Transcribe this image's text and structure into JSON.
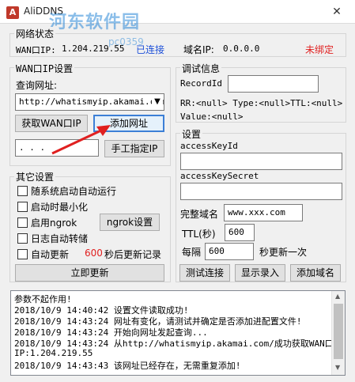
{
  "window": {
    "title": "AliDDNS",
    "watermark": "河东软件园",
    "watermark_url": "pc0359"
  },
  "net_status": {
    "title": "网络状态",
    "wan_label": "WAN口IP:",
    "wan_ip": "1.204.219.55",
    "connected": "已连接",
    "domain_ip_label": "域名IP:",
    "domain_ip": "0.0.0.0",
    "bind_status": "未绑定"
  },
  "wan_settings": {
    "title": "WAN口IP设置",
    "query_label": "查询网址:",
    "query_url": "http://whatismyip.akamai.com",
    "get_wan_button": "获取WAN口IP",
    "add_url_button": "添加网址",
    "manual_ip": "  .   .   .",
    "manual_ip_button": "手工指定IP"
  },
  "other_settings": {
    "title": "其它设置",
    "options": [
      {
        "label": "随系统启动自动运行"
      },
      {
        "label": "启动时最小化"
      },
      {
        "label": "启用ngrok"
      },
      {
        "label": "日志自动转储"
      },
      {
        "label": "自动更新"
      }
    ],
    "ngrok_button": "ngrok设置",
    "update_seconds": "600",
    "update_suffix": "秒后更新记录",
    "update_now_button": "立即更新"
  },
  "debug_info": {
    "title": "调试信息",
    "record_id_label": "RecordId",
    "record_id_value": "",
    "rr_line": "RR:<null> Type:<null>TTL:<null>",
    "value_line": "Value:<null>"
  },
  "settings": {
    "title": "设置",
    "access_key_id_label": "accessKeyId",
    "access_key_id_value": "",
    "access_key_secret_label": "accessKeySecret",
    "access_key_secret_value": "",
    "full_domain_label": "完整域名",
    "full_domain_value": "www.xxx.com",
    "ttl_label": "TTL(秒)",
    "ttl_value": "600",
    "interval_label": "每隔",
    "interval_value": "600",
    "interval_suffix": "秒更新一次",
    "test_button": "测试连接",
    "show_records_button": "显示录入",
    "add_domain_button": "添加域名"
  },
  "log": [
    "参数不起作用!",
    "2018/10/9 14:40:42 设置文件读取成功!",
    "2018/10/9 14:43:24 网址有变化，请测试并确定是否添加进配置文件!",
    "2018/10/9 14:43:24 开始向网址发起查询...",
    "2018/10/9 14:43:24 从http://whatismyip.akamai.com/成功获取WAN口",
    "IP:1.204.219.55",
    "2018/10/9 14:43:43 该网址已经存在，无需重复添加!"
  ]
}
